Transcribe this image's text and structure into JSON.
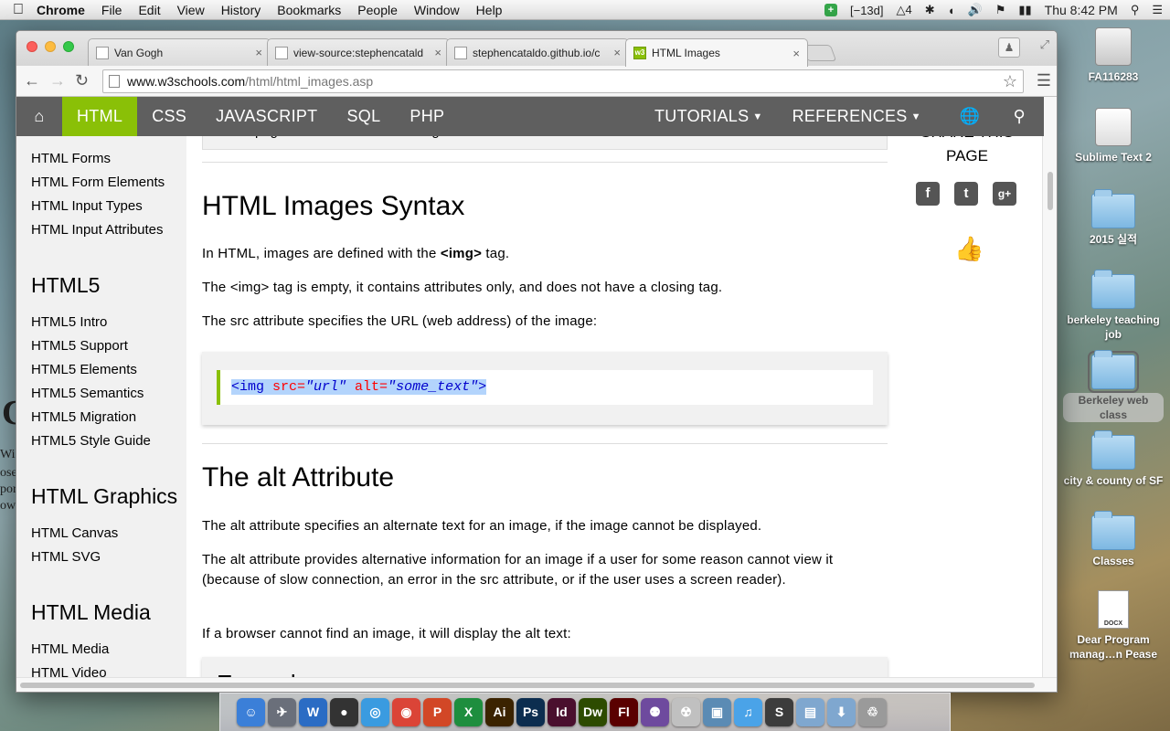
{
  "menubar": {
    "app_name": "Chrome",
    "menus": [
      "File",
      "Edit",
      "View",
      "History",
      "Bookmarks",
      "People",
      "Window",
      "Help"
    ],
    "status_days": "[−13d]",
    "status_a": "4",
    "clock": "Thu 8:42 PM"
  },
  "desktop": {
    "icons": [
      {
        "label": "FA116283",
        "kind": "drive"
      },
      {
        "label": "Sublime Text 2",
        "kind": "drive"
      },
      {
        "label": "2015 실적",
        "kind": "folder"
      },
      {
        "label": "berkeley teaching job",
        "kind": "folder"
      },
      {
        "label": "Berkeley web class",
        "kind": "folder"
      },
      {
        "label": "city & county of SF",
        "kind": "folder"
      },
      {
        "label": "Classes",
        "kind": "folder"
      },
      {
        "label": "Dear Program manag…n Pease",
        "kind": "docx"
      }
    ],
    "docx_badge": "DOCX"
  },
  "browser": {
    "tabs": [
      {
        "title": "Van Gogh",
        "active": false
      },
      {
        "title": "view-source:stephencatald",
        "active": false
      },
      {
        "title": "stephencataldo.github.io/c",
        "active": false
      },
      {
        "title": "HTML Images",
        "active": true
      }
    ],
    "url_host": "www.w3schools.com",
    "url_path": "/html/html_images.asp"
  },
  "w3nav": {
    "items": [
      "HTML",
      "CSS",
      "JAVASCRIPT",
      "SQL",
      "PHP"
    ],
    "right_items": [
      "TUTORIALS",
      "REFERENCES"
    ]
  },
  "sidebar": {
    "links_top": [
      "HTML Forms",
      "HTML Form Elements",
      "HTML Input Types",
      "HTML Input Attributes"
    ],
    "html5_heading": "HTML5",
    "html5_links": [
      "HTML5 Intro",
      "HTML5 Support",
      "HTML5 Elements",
      "HTML5 Semantics",
      "HTML5 Migration",
      "HTML5 Style Guide"
    ],
    "graphics_heading": "HTML Graphics",
    "graphics_links": [
      "HTML Canvas",
      "HTML SVG"
    ],
    "media_heading": "HTML Media",
    "media_links": [
      "HTML Media",
      "HTML Video"
    ]
  },
  "main": {
    "tip_text": "page will flicker while the image loads.",
    "syntax_heading": "HTML Images Syntax",
    "p1_prefix": "In HTML, images are defined with the ",
    "p1_bold": "<img>",
    "p1_suffix": " tag.",
    "p2": "The <img> tag is empty, it contains attributes only, and does not have a closing tag.",
    "p3": "The src attribute specifies the URL (web address) of the image:",
    "code": {
      "tag_open": "<img",
      "attr1": " src=",
      "val1": "\"url\"",
      "attr2": " alt=",
      "val2": "\"some_text\"",
      "tag_close": ">"
    },
    "alt_heading": "The alt Attribute",
    "p4": "The alt attribute specifies an alternate text for an image, if the image cannot be displayed.",
    "p5": "The alt attribute provides alternative information for an image if a user for some reason cannot view it (because of slow connection, an error in the src attribute, or if the user uses a screen reader).",
    "p6": "If a browser cannot find an image, it will display the alt text:",
    "example_label": "Example"
  },
  "right_col": {
    "share_line1": "SHARE THIS",
    "share_line2": "PAGE"
  },
  "dock": {
    "apps": [
      {
        "name": "finder",
        "glyph": "☺",
        "color": "#3b7fd8"
      },
      {
        "name": "launchpad",
        "glyph": "✈",
        "color": "#6a6f7a"
      },
      {
        "name": "word",
        "glyph": "W",
        "color": "#2b6cc4"
      },
      {
        "name": "dashboard",
        "glyph": "●",
        "color": "#333333"
      },
      {
        "name": "safari",
        "glyph": "◎",
        "color": "#3a9be0"
      },
      {
        "name": "chrome",
        "glyph": "◉",
        "color": "#db4437"
      },
      {
        "name": "powerpoint",
        "glyph": "P",
        "color": "#d24726"
      },
      {
        "name": "excel",
        "glyph": "X",
        "color": "#1e8e3e"
      },
      {
        "name": "illustrator",
        "glyph": "Ai",
        "color": "#3b2300"
      },
      {
        "name": "photoshop",
        "glyph": "Ps",
        "color": "#0c2d4f"
      },
      {
        "name": "indesign",
        "glyph": "Id",
        "color": "#4a0f2e"
      },
      {
        "name": "dreamweaver",
        "glyph": "Dw",
        "color": "#2d4b00"
      },
      {
        "name": "flash",
        "glyph": "Fl",
        "color": "#5a0000"
      },
      {
        "name": "github",
        "glyph": "⚉",
        "color": "#6e4a9e"
      },
      {
        "name": "acrobat",
        "glyph": "☢",
        "color": "#c0c0c0"
      },
      {
        "name": "preview",
        "glyph": "▣",
        "color": "#5b8bb4"
      },
      {
        "name": "itunes",
        "glyph": "♫",
        "color": "#4aa3e8"
      },
      {
        "name": "sublime",
        "glyph": "S",
        "color": "#3c3c3c"
      },
      {
        "name": "applications",
        "glyph": "▤",
        "color": "#7fa7cf"
      },
      {
        "name": "downloads",
        "glyph": "⬇",
        "color": "#7fa7cf"
      },
      {
        "name": "trash",
        "glyph": "♲",
        "color": "#9a9a9a"
      }
    ]
  },
  "background_window": {
    "lines": [
      "Wil",
      "ose",
      "por",
      "ow"
    ],
    "big_letter": "C"
  }
}
